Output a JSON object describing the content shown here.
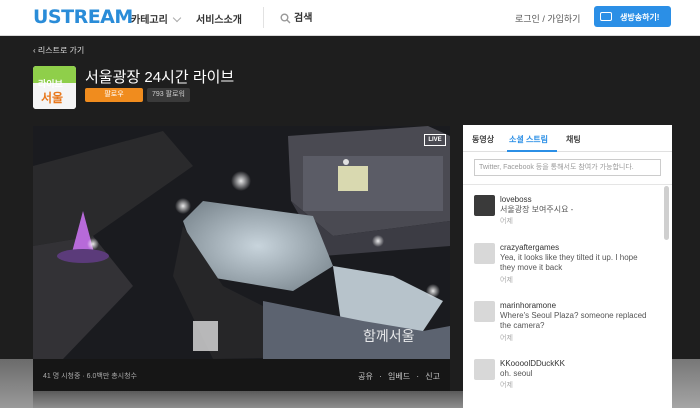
{
  "header": {
    "logo": "USTREAM",
    "nav_category": "카테고리",
    "nav_service": "서비스소개",
    "search_label": "검색",
    "login": "로그인 / 가입하기",
    "broadcast_button": "생방송하기!"
  },
  "channel": {
    "back_link": "리스트로 가기",
    "logo_text_top": "라이브",
    "logo_text_bottom": "서울",
    "title": "서울광장 24시간 라이브",
    "follow_button": "팔로우",
    "follower_count": "793 팔로워"
  },
  "video": {
    "live_badge": "LIVE",
    "stats": "41 명 시청중  ·  6.0백만 총시청수",
    "share": "공유",
    "embed": "임베드",
    "report": "신고",
    "sep": "·"
  },
  "panel": {
    "tabs": [
      "동영상",
      "소셜 스트림",
      "채팅"
    ],
    "active_tab": "소셜 스트림",
    "input_placeholder": "Twitter, Facebook 등을 통해서도 참여가 가능합니다.",
    "messages": [
      {
        "user": "loveboss",
        "text": "서울광장 보여주시요 -",
        "time": "어제"
      },
      {
        "user": "crazyaftergames",
        "text": "Yea, it looks like they tilted it up. I hope they move it back",
        "time": "어제"
      },
      {
        "user": "marinhoramone",
        "text": "Where's Seoul Plaza? someone replaced the camera?",
        "time": "어제"
      },
      {
        "user": "KKoooolDDuckKK",
        "text": "oh. seoul",
        "time": "어제"
      }
    ]
  },
  "colors": {
    "brand_blue": "#2b8fe6",
    "follow_orange": "#f08c1e"
  }
}
